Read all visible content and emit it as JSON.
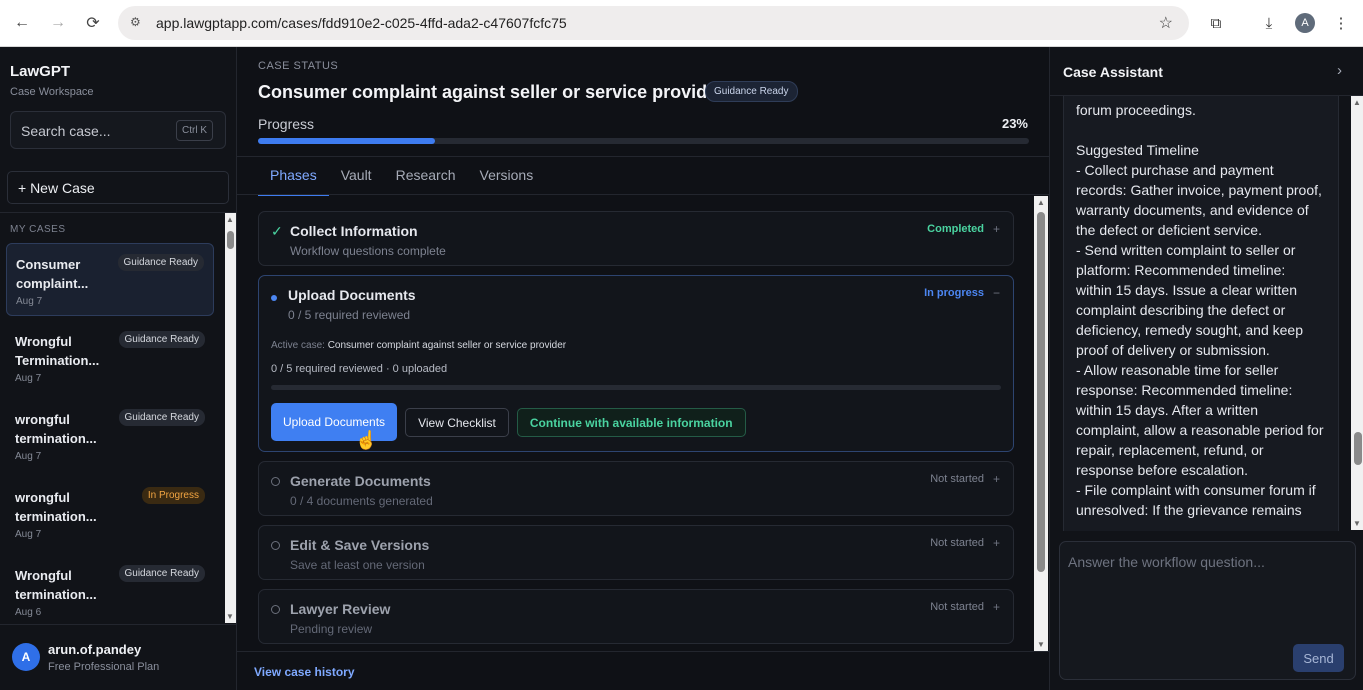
{
  "browser": {
    "url": "app.lawgptapp.com/cases/fdd910e2-c025-4ffd-ada2-c47607fcfc75",
    "profile_initial": "A"
  },
  "sidebar": {
    "brand": "LawGPT",
    "subtitle": "Case Workspace",
    "search_placeholder": "Search case...",
    "search_shortcut": "Ctrl K",
    "new_case_label": "+ New Case",
    "section_label": "MY CASES",
    "cases": [
      {
        "title": "Consumer complaint...",
        "date": "Aug 7",
        "badge": "Guidance Ready",
        "active": true
      },
      {
        "title": "Wrongful Termination...",
        "date": "Aug 7",
        "badge": "Guidance Ready",
        "active": false
      },
      {
        "title": "wrongful termination...",
        "date": "Aug 7",
        "badge": "Guidance Ready",
        "active": false
      },
      {
        "title": "wrongful termination...",
        "date": "Aug 7",
        "badge": "In Progress",
        "active": false
      },
      {
        "title": "Wrongful termination...",
        "date": "Aug 6",
        "badge": "Guidance Ready",
        "active": false
      }
    ],
    "user": {
      "initial": "A",
      "name": "arun.of.pandey",
      "plan": "Free Professional Plan"
    }
  },
  "main": {
    "status_label": "CASE STATUS",
    "case_title": "Consumer complaint against seller or service provider",
    "case_badge": "Guidance Ready",
    "progress_label": "Progress",
    "progress_text": "23%",
    "progress_value": 0.23,
    "tabs": [
      "Phases",
      "Vault",
      "Research",
      "Versions"
    ],
    "active_tab": "Phases",
    "phases": [
      {
        "title": "Collect Information",
        "sub": "Workflow questions complete",
        "status": "Completed",
        "toggle": "+"
      },
      {
        "title": "Upload Documents",
        "sub": "0 / 5 required reviewed",
        "status": "In progress",
        "toggle": "−",
        "active_case_label": "Active case:",
        "active_case": "Consumer complaint against seller or service provider",
        "summary": "0 / 5 required reviewed · 0 uploaded",
        "buttons": {
          "upload": "Upload Documents",
          "checklist": "View Checklist",
          "continue": "Continue with available information"
        }
      },
      {
        "title": "Generate Documents",
        "sub": "0 / 4 documents generated",
        "status": "Not started",
        "toggle": "+"
      },
      {
        "title": "Edit & Save Versions",
        "sub": "Save at least one version",
        "status": "Not started",
        "toggle": "+"
      },
      {
        "title": "Lawyer Review",
        "sub": "Pending review",
        "status": "Not started",
        "toggle": "+"
      }
    ],
    "history_link": "View case history"
  },
  "assistant": {
    "title": "Case Assistant",
    "message": "forum proceedings.\n\nSuggested Timeline\n- Collect purchase and payment records: Gather invoice, payment proof, warranty documents, and evidence of the defect or deficient service.\n- Send written complaint to seller or platform: Recommended timeline: within 15 days. Issue a clear written complaint describing the defect or deficiency, remedy sought, and keep proof of delivery or submission.\n- Allow reasonable time for seller response: Recommended timeline: within 15 days. After a written complaint, allow a reasonable period for repair, replacement, refund, or response before escalation.\n- File complaint with consumer forum if unresolved: If the grievance remains",
    "input_placeholder": "Answer the workflow question...",
    "send_label": "Send"
  },
  "colors": {
    "accent": "#3e7cf0",
    "completed": "#4ad3a0",
    "in_progress": "#4c86f2",
    "warning": "#f3a542"
  }
}
